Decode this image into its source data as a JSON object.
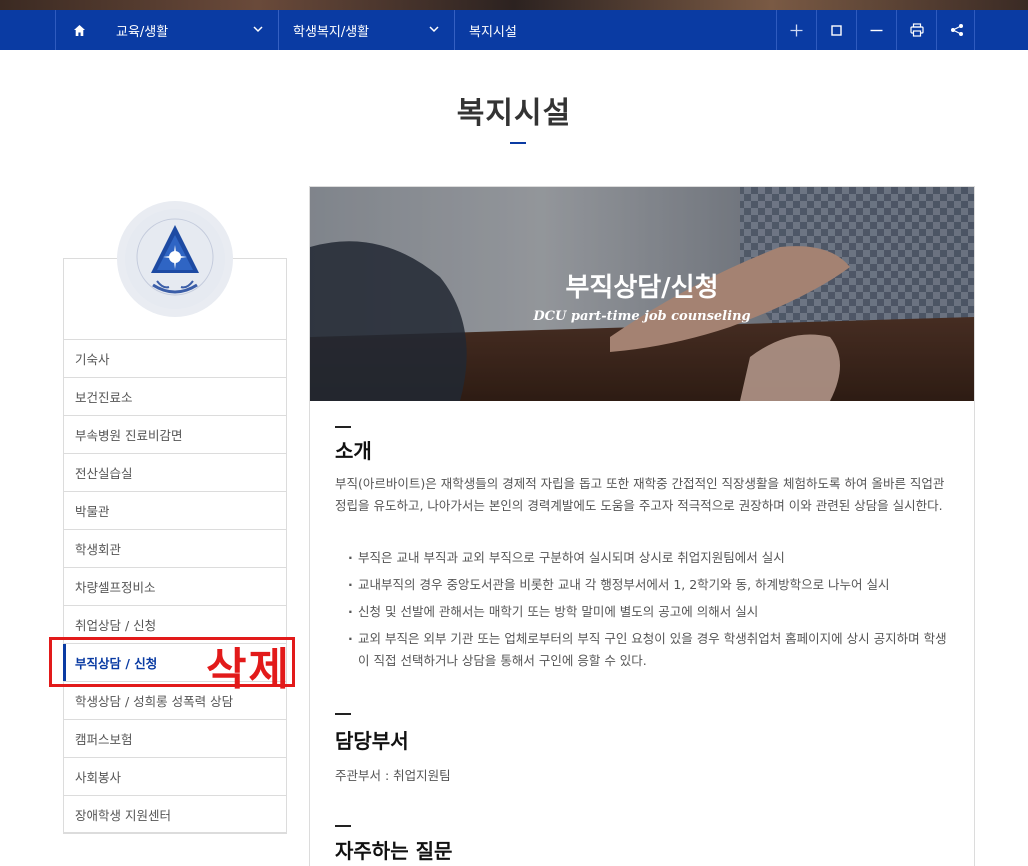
{
  "nav": {
    "crumb1": "교육/생활",
    "crumb2": "학생복지/생활",
    "crumb3": "복지시설"
  },
  "page": {
    "title": "복지시설"
  },
  "sidebar": {
    "items": [
      {
        "label": "기숙사"
      },
      {
        "label": "보건진료소"
      },
      {
        "label": "부속병원 진료비감면"
      },
      {
        "label": "전산실습실"
      },
      {
        "label": "박물관"
      },
      {
        "label": "학생회관"
      },
      {
        "label": "차량셀프정비소"
      },
      {
        "label": "취업상담 / 신청"
      },
      {
        "label": "부직상담 / 신청"
      },
      {
        "label": "학생상담 / 성희롱 성폭력 상담"
      },
      {
        "label": "캠퍼스보험"
      },
      {
        "label": "사회봉사"
      },
      {
        "label": "장애학생 지원센터"
      }
    ],
    "active_index": 8
  },
  "annotation": {
    "label": "삭제",
    "color": "#e21a1a"
  },
  "hero": {
    "title": "부직상담/신청",
    "subtitle": "DCU part-time job counseling"
  },
  "sections": {
    "intro_title": "소개",
    "intro_text": "부직(아르바이트)은 재학생들의 경제적 자립을 돕고 또한 재학중 간접적인 직장생활을 체험하도록 하여 올바른 직업관 정립을 유도하고, 나아가서는 본인의 경력계발에도 도움을 주고자 적극적으로 권장하며 이와 관련된 상담을 실시한다.",
    "bullets": [
      "부직은 교내 부직과 교외 부직으로 구분하여 실시되며 상시로 취업지원팀에서 실시",
      "교내부직의 경우 중앙도서관을 비롯한 교내 각 행정부서에서 1, 2학기와 동, 하계방학으로 나누어 실시",
      "신청 및 선발에 관해서는 매학기 또는 방학 말미에 별도의 공고에 의해서 실시",
      "교외 부직은 외부 기관 또는 업체로부터의 부직 구인 요청이 있을 경우 학생취업처 홈페이지에 상시 공지하며 학생이 직접 선택하거나 상담을 통해서 구인에 응할 수 있다."
    ],
    "dept_title": "담당부서",
    "dept_text": "주관부서 : 취업지원팀",
    "faq_title": "자주하는 질문"
  },
  "colors": {
    "nav_bg": "#0a3ba3",
    "accent": "#0a3ba3",
    "annotation": "#e21a1a"
  }
}
